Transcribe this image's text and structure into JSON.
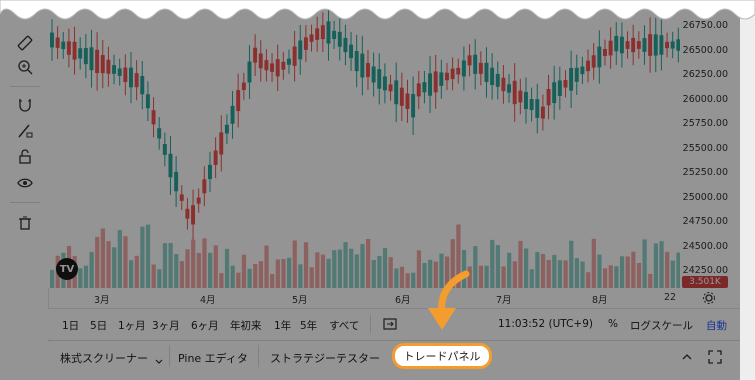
{
  "price_axis": [
    "26750.00",
    "26500.00",
    "26250.00",
    "26000.00",
    "25750.00",
    "25500.00",
    "25250.00",
    "25000.00",
    "24750.00",
    "24500.00",
    "24250.00"
  ],
  "current_price": "3.501K",
  "time_axis": [
    {
      "label": "3月"
    },
    {
      "label": "4月"
    },
    {
      "label": "5月"
    },
    {
      "label": "6月"
    },
    {
      "label": "7月"
    },
    {
      "label": "8月"
    },
    {
      "label": "22"
    }
  ],
  "range_buttons": [
    "1日",
    "5日",
    "1ヶ月",
    "3ヶ月",
    "6ヶ月",
    "年初来",
    "1年",
    "5年",
    "すべて"
  ],
  "clock": "11:03:52 (UTC+9)",
  "percent_label": "%",
  "log_label": "ログスケール",
  "auto_label": "自動",
  "bottom_tabs": {
    "screener": "株式スクリーナー",
    "pine": "Pine エディタ",
    "strategy": "ストラテジーテスター",
    "trade": "トレードパネル"
  },
  "logo_text": "TV",
  "colors": {
    "up": "#26a69a",
    "down": "#ef5350",
    "accent": "#f29d2e",
    "auto": "#2962ff"
  },
  "icons": [
    "ruler-icon",
    "zoom-in-icon",
    "magnet-icon",
    "lock-pencil-icon",
    "lock-icon",
    "eye-icon",
    "trash-icon",
    "replay-icon",
    "chevron-down-icon",
    "chevron-up-icon",
    "fullscreen-icon",
    "settings-icon"
  ]
}
